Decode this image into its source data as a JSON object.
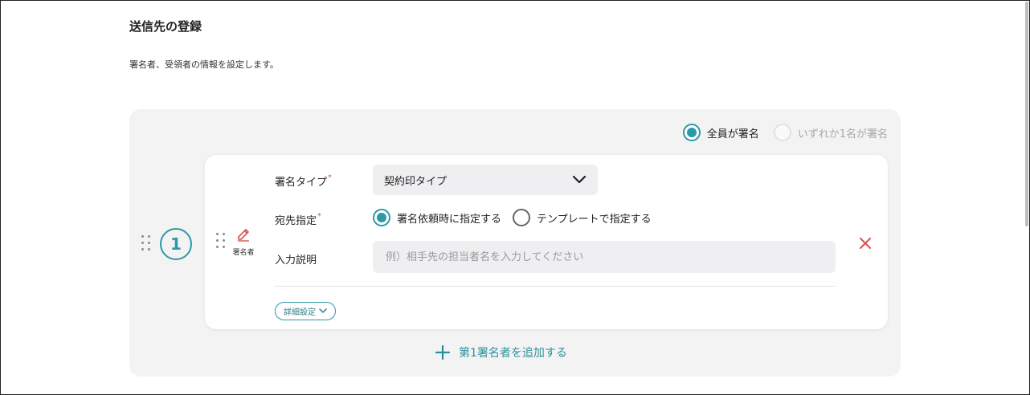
{
  "page": {
    "title": "送信先の登録",
    "description": "署名者、受領者の情報を設定します。"
  },
  "sign_mode": {
    "options": [
      {
        "label": "全員が署名",
        "selected": true,
        "enabled": true
      },
      {
        "label": "いずれか1名が署名",
        "selected": false,
        "enabled": false
      }
    ]
  },
  "signer": {
    "order": "1",
    "role_label": "署名者",
    "signature_type": {
      "label": "署名タイプ",
      "required_mark": "*",
      "value": "契約印タイプ"
    },
    "destination": {
      "label": "宛先指定",
      "required_mark": "*",
      "options": [
        {
          "label": "署名依頼時に指定する",
          "selected": true
        },
        {
          "label": "テンプレートで指定する",
          "selected": false
        }
      ]
    },
    "input_description": {
      "label": "入力説明",
      "value": "",
      "placeholder": "例）相手先の担当者名を入力してください"
    },
    "detail_button": "詳細設定"
  },
  "add_signer": {
    "label": "第1署名者を追加する"
  },
  "colors": {
    "accent": "#2b9aa6",
    "remove": "#d9534f",
    "role_icon": "#d9534f"
  }
}
